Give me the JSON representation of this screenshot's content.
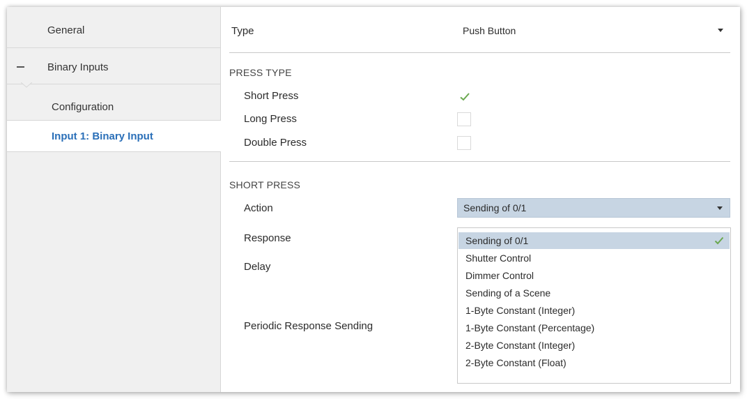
{
  "sidebar": {
    "items": [
      {
        "label": "General"
      },
      {
        "label": "Binary Inputs"
      },
      {
        "label": "Configuration"
      },
      {
        "label": "Input 1: Binary Input"
      }
    ]
  },
  "main": {
    "type": {
      "label": "Type",
      "value": "Push Button"
    },
    "press_type": {
      "title": "PRESS TYPE",
      "options": [
        {
          "label": "Short Press",
          "checked": true
        },
        {
          "label": "Long Press",
          "checked": false
        },
        {
          "label": "Double Press",
          "checked": false
        }
      ]
    },
    "short_press": {
      "title": "SHORT PRESS",
      "action": {
        "label": "Action",
        "value": "Sending of 0/1"
      },
      "response_label": "Response",
      "delay_label": "Delay",
      "periodic_label": "Periodic Response Sending",
      "dropdown_options": [
        "Sending of 0/1",
        "Shutter Control",
        "Dimmer Control",
        "Sending of a Scene",
        "1-Byte Constant (Integer)",
        "1-Byte Constant (Percentage)",
        "2-Byte Constant (Integer)",
        "2-Byte Constant (Float)"
      ],
      "dropdown_selected_index": 0
    }
  },
  "colors": {
    "accent_text": "#2a6fb8",
    "selection": "#c7d5e3",
    "check": "#6aa84f"
  },
  "icons": {
    "collapse": "minus-icon",
    "dropdown_arrow": "caret-down-icon",
    "check": "check-icon"
  }
}
